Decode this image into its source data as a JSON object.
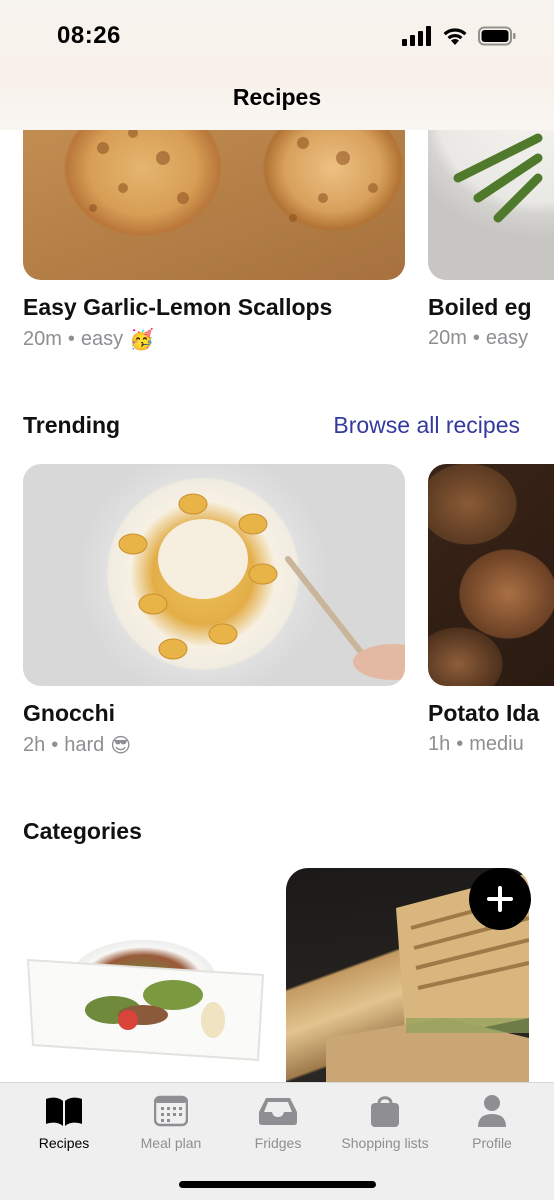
{
  "status_bar": {
    "time": "08:26"
  },
  "header": {
    "title": "Recipes"
  },
  "featured": [
    {
      "title": "Easy Garlic-Lemon Scallops",
      "time": "20m",
      "difficulty": "easy",
      "emoji": "🥳"
    },
    {
      "title": "Boiled eg",
      "time": "20m",
      "difficulty": "easy",
      "emoji": ""
    }
  ],
  "trending": {
    "title": "Trending",
    "link": "Browse all recipes",
    "items": [
      {
        "title": "Gnocchi",
        "time": "2h",
        "difficulty": "hard",
        "emoji": "😎"
      },
      {
        "title": "Potato Ida",
        "time": "1h",
        "difficulty": "mediu",
        "emoji": ""
      }
    ]
  },
  "categories": {
    "title": "Categories"
  },
  "meta_separator": "•",
  "tabs": [
    {
      "label": "Recipes",
      "icon": "book-icon",
      "active": true
    },
    {
      "label": "Meal plan",
      "icon": "calendar-icon",
      "active": false
    },
    {
      "label": "Fridges",
      "icon": "inbox-tray-icon",
      "active": false
    },
    {
      "label": "Shopping lists",
      "icon": "shopping-bag-icon",
      "active": false
    },
    {
      "label": "Profile",
      "icon": "person-icon",
      "active": false
    }
  ]
}
